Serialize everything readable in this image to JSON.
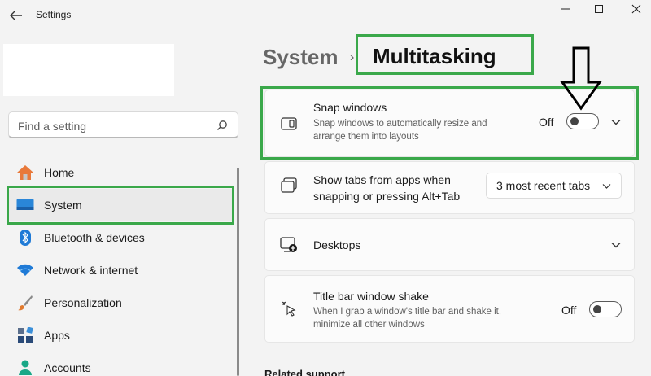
{
  "window": {
    "title": "Settings"
  },
  "search": {
    "placeholder": "Find a setting"
  },
  "nav": [
    {
      "label": "Home",
      "icon": "home-icon"
    },
    {
      "label": "System",
      "icon": "system-icon",
      "selected": true
    },
    {
      "label": "Bluetooth & devices",
      "icon": "bluetooth-icon"
    },
    {
      "label": "Network & internet",
      "icon": "wifi-icon"
    },
    {
      "label": "Personalization",
      "icon": "brush-icon"
    },
    {
      "label": "Apps",
      "icon": "apps-icon"
    },
    {
      "label": "Accounts",
      "icon": "person-icon"
    }
  ],
  "breadcrumb": {
    "parent": "System",
    "separator": "›",
    "current": "Multitasking"
  },
  "settings": {
    "snap": {
      "title": "Snap windows",
      "desc": "Snap windows to automatically resize and arrange them into layouts",
      "state_label": "Off",
      "on": false
    },
    "tabs": {
      "title": "Show tabs from apps when snapping or pressing Alt+Tab",
      "value": "3 most recent tabs"
    },
    "desktops": {
      "title": "Desktops"
    },
    "shake": {
      "title": "Title bar window shake",
      "desc": "When I grab a window's title bar and shake it, minimize all other windows",
      "state_label": "Off",
      "on": false
    }
  },
  "related": {
    "label": "Related support"
  },
  "colors": {
    "highlight": "#3aa84a",
    "accent": "#0067c0",
    "background": "#f3f3f3"
  }
}
